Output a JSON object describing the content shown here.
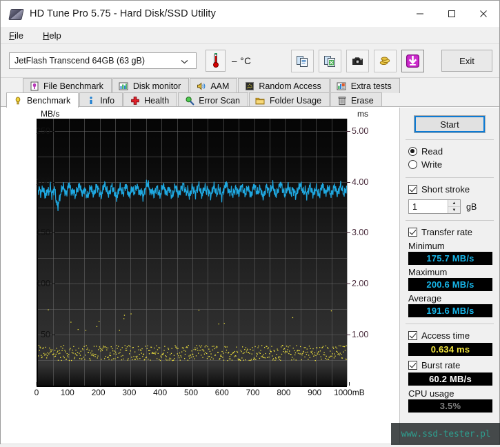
{
  "window": {
    "title": "HD Tune Pro 5.75 - Hard Disk/SSD Utility",
    "icon": "hd-tune-disk-icon",
    "minimize": "—",
    "maximize": "□",
    "close": "✕"
  },
  "menu": [
    {
      "label": "File"
    },
    {
      "label": "Help"
    }
  ],
  "toolbar": {
    "drive": "JetFlash Transcend 64GB (63 gB)",
    "drive_chevron": "⌄",
    "temperature": "– °C",
    "buttons": [
      {
        "name": "copy-icon",
        "title": "Copy"
      },
      {
        "name": "copy-excel-icon",
        "title": "Copy to Excel"
      },
      {
        "name": "camera-icon",
        "title": "Screenshot"
      },
      {
        "name": "coins-icon",
        "title": "Donate"
      },
      {
        "name": "download-arrow-icon",
        "title": "Download"
      }
    ],
    "exit_label": "Exit"
  },
  "tabs": {
    "top_row": [
      {
        "label": "File Benchmark",
        "icon": "file-benchmark-icon",
        "active": false
      },
      {
        "label": "Disk monitor",
        "icon": "disk-monitor-icon",
        "active": false
      },
      {
        "label": "AAM",
        "icon": "speaker-icon",
        "active": false
      },
      {
        "label": "Random Access",
        "icon": "random-access-icon",
        "active": false
      },
      {
        "label": "Extra tests",
        "icon": "extra-tests-icon",
        "active": false
      }
    ],
    "bottom_row": [
      {
        "label": "Benchmark",
        "icon": "lightbulb-icon",
        "active": true
      },
      {
        "label": "Info",
        "icon": "info-icon",
        "active": false
      },
      {
        "label": "Health",
        "icon": "health-cross-icon",
        "active": false
      },
      {
        "label": "Error Scan",
        "icon": "magnifier-icon",
        "active": false
      },
      {
        "label": "Folder Usage",
        "icon": "folder-icon",
        "active": false
      },
      {
        "label": "Erase",
        "icon": "trash-icon",
        "active": false
      }
    ]
  },
  "panel": {
    "start_label": "Start",
    "mode": {
      "read_label": "Read",
      "write_label": "Write",
      "read_selected": true,
      "write_selected": false
    },
    "short_stroke": {
      "label": "Short stroke",
      "checked": true,
      "value": "1",
      "unit": "gB",
      "spin_up": "▲",
      "spin_down": "▼"
    },
    "transfer_rate": {
      "label": "Transfer rate",
      "checked": true,
      "minimum_label": "Minimum",
      "minimum_value": "175.7 MB/s",
      "maximum_label": "Maximum",
      "maximum_value": "200.6 MB/s",
      "average_label": "Average",
      "average_value": "191.6 MB/s"
    },
    "access_time": {
      "label": "Access time",
      "checked": true,
      "value": "0.634 ms"
    },
    "burst_rate": {
      "label": "Burst rate",
      "checked": true,
      "value": "60.2 MB/s"
    },
    "cpu_usage": {
      "label": "CPU usage",
      "value": "3.5%"
    }
  },
  "watermark": "www.ssd-tester.pl",
  "colors": {
    "transfer_line": "#1FA8E0",
    "access_dots": "#F2E53C",
    "lcd_background": "#000000",
    "accent_focus": "#0D7BD4"
  },
  "chart_data": {
    "type": "line",
    "title": "",
    "xlabel": "1000mB",
    "ylabel": "MB/s",
    "y2label": "ms",
    "xlim": [
      0,
      1000
    ],
    "ylim": [
      0,
      262
    ],
    "y2lim": [
      0,
      5.24
    ],
    "grid": true,
    "legend": "none",
    "x_ticks": [
      0,
      100,
      200,
      300,
      400,
      500,
      600,
      700,
      800,
      900,
      1000
    ],
    "x_tick_labels": [
      "0",
      "100",
      "200",
      "300",
      "400",
      "500",
      "600",
      "700",
      "800",
      "900",
      "1000mB"
    ],
    "y_ticks_left": [
      50,
      100,
      150,
      200,
      250
    ],
    "y_tick_labels_left": [
      "50",
      "100",
      "150",
      "200",
      "250"
    ],
    "y_ticks_right": [
      1.0,
      2.0,
      3.0,
      4.0,
      5.0
    ],
    "y_tick_labels_right": [
      "1.00",
      "2.00",
      "3.00",
      "4.00",
      "5.00"
    ],
    "grid_x_step": 50,
    "grid_y_step": 25,
    "series": [
      {
        "name": "Transfer rate",
        "axis": "left",
        "unit": "MB/s",
        "color": "#1FA8E0",
        "type": "line",
        "x": [
          0,
          5,
          10,
          15,
          20,
          25,
          30,
          35,
          40,
          45,
          50,
          55,
          60,
          65,
          70,
          75,
          80,
          85,
          90,
          95,
          100,
          105,
          110,
          115,
          120,
          125,
          130,
          135,
          140,
          145,
          150,
          155,
          160,
          165,
          170,
          175,
          180,
          185,
          190,
          195,
          200,
          205,
          210,
          215,
          220,
          225,
          230,
          235,
          240,
          245,
          250,
          255,
          260,
          265,
          270,
          275,
          280,
          285,
          290,
          295,
          300,
          305,
          310,
          315,
          320,
          325,
          330,
          335,
          340,
          345,
          350,
          355,
          360,
          365,
          370,
          375,
          380,
          385,
          390,
          395,
          400,
          405,
          410,
          415,
          420,
          425,
          430,
          435,
          440,
          445,
          450,
          455,
          460,
          465,
          470,
          475,
          480,
          485,
          490,
          495,
          500,
          505,
          510,
          515,
          520,
          525,
          530,
          535,
          540,
          545,
          550,
          555,
          560,
          565,
          570,
          575,
          580,
          585,
          590,
          595,
          600,
          605,
          610,
          615,
          620,
          625,
          630,
          635,
          640,
          645,
          650,
          655,
          660,
          665,
          670,
          675,
          680,
          685,
          690,
          695,
          700,
          705,
          710,
          715,
          720,
          725,
          730,
          735,
          740,
          745,
          750,
          755,
          760,
          765,
          770,
          775,
          780,
          785,
          790,
          795,
          800,
          805,
          810,
          815,
          820,
          825,
          830,
          835,
          840,
          845,
          850,
          855,
          860,
          865,
          870,
          875,
          880,
          885,
          890,
          895,
          900,
          905,
          910,
          915,
          920,
          925,
          930,
          935,
          940,
          945,
          950,
          955,
          960,
          965,
          970,
          975,
          980,
          985,
          990,
          995,
          1000
        ],
        "y": [
          191,
          193,
          188,
          194,
          190,
          186,
          192,
          189,
          195,
          187,
          191,
          193,
          179,
          176,
          184,
          190,
          196,
          193,
          188,
          191,
          198,
          194,
          189,
          192,
          186,
          190,
          194,
          197,
          191,
          188,
          193,
          190,
          185,
          189,
          195,
          192,
          187,
          191,
          196,
          193,
          189,
          186,
          192,
          198,
          194,
          190,
          187,
          193,
          196,
          191,
          188,
          184,
          190,
          195,
          192,
          188,
          193,
          197,
          191,
          186,
          190,
          194,
          189,
          192,
          196,
          193,
          188,
          191,
          185,
          190,
          196,
          199,
          194,
          189,
          192,
          187,
          191,
          195,
          190,
          186,
          192,
          197,
          193,
          188,
          191,
          194,
          189,
          185,
          191,
          196,
          192,
          187,
          190,
          194,
          198,
          193,
          189,
          192,
          186,
          190,
          195,
          191,
          188,
          193,
          197,
          192,
          187,
          191,
          195,
          190,
          193,
          189,
          186,
          192,
          196,
          191,
          188,
          194,
          190,
          185,
          191,
          195,
          198,
          193,
          189,
          192,
          187,
          190,
          194,
          191,
          188,
          193,
          196,
          192,
          187,
          191,
          195,
          190,
          186,
          192,
          197,
          193,
          189,
          191,
          194,
          188,
          185,
          190,
          196,
          192,
          189,
          193,
          197,
          191,
          187,
          190,
          194,
          199,
          195,
          190,
          187,
          192,
          196,
          191,
          188,
          193,
          190,
          186,
          191,
          195,
          198,
          193,
          189,
          192,
          187,
          191,
          196,
          192,
          188,
          190,
          194,
          191,
          186,
          192,
          197,
          193,
          189,
          191,
          195,
          190,
          187,
          192,
          196,
          191,
          188,
          193,
          197,
          192,
          188,
          191,
          195,
          190,
          193
        ]
      },
      {
        "name": "Access time",
        "axis": "right",
        "unit": "ms",
        "color": "#F2E53C",
        "type": "scatter",
        "mean_ms": 0.634,
        "band_ms": [
          0.5,
          0.8
        ],
        "outlier_ms": [
          1.15,
          1.3,
          1.05,
          1.22
        ],
        "point_count": 560
      }
    ]
  }
}
